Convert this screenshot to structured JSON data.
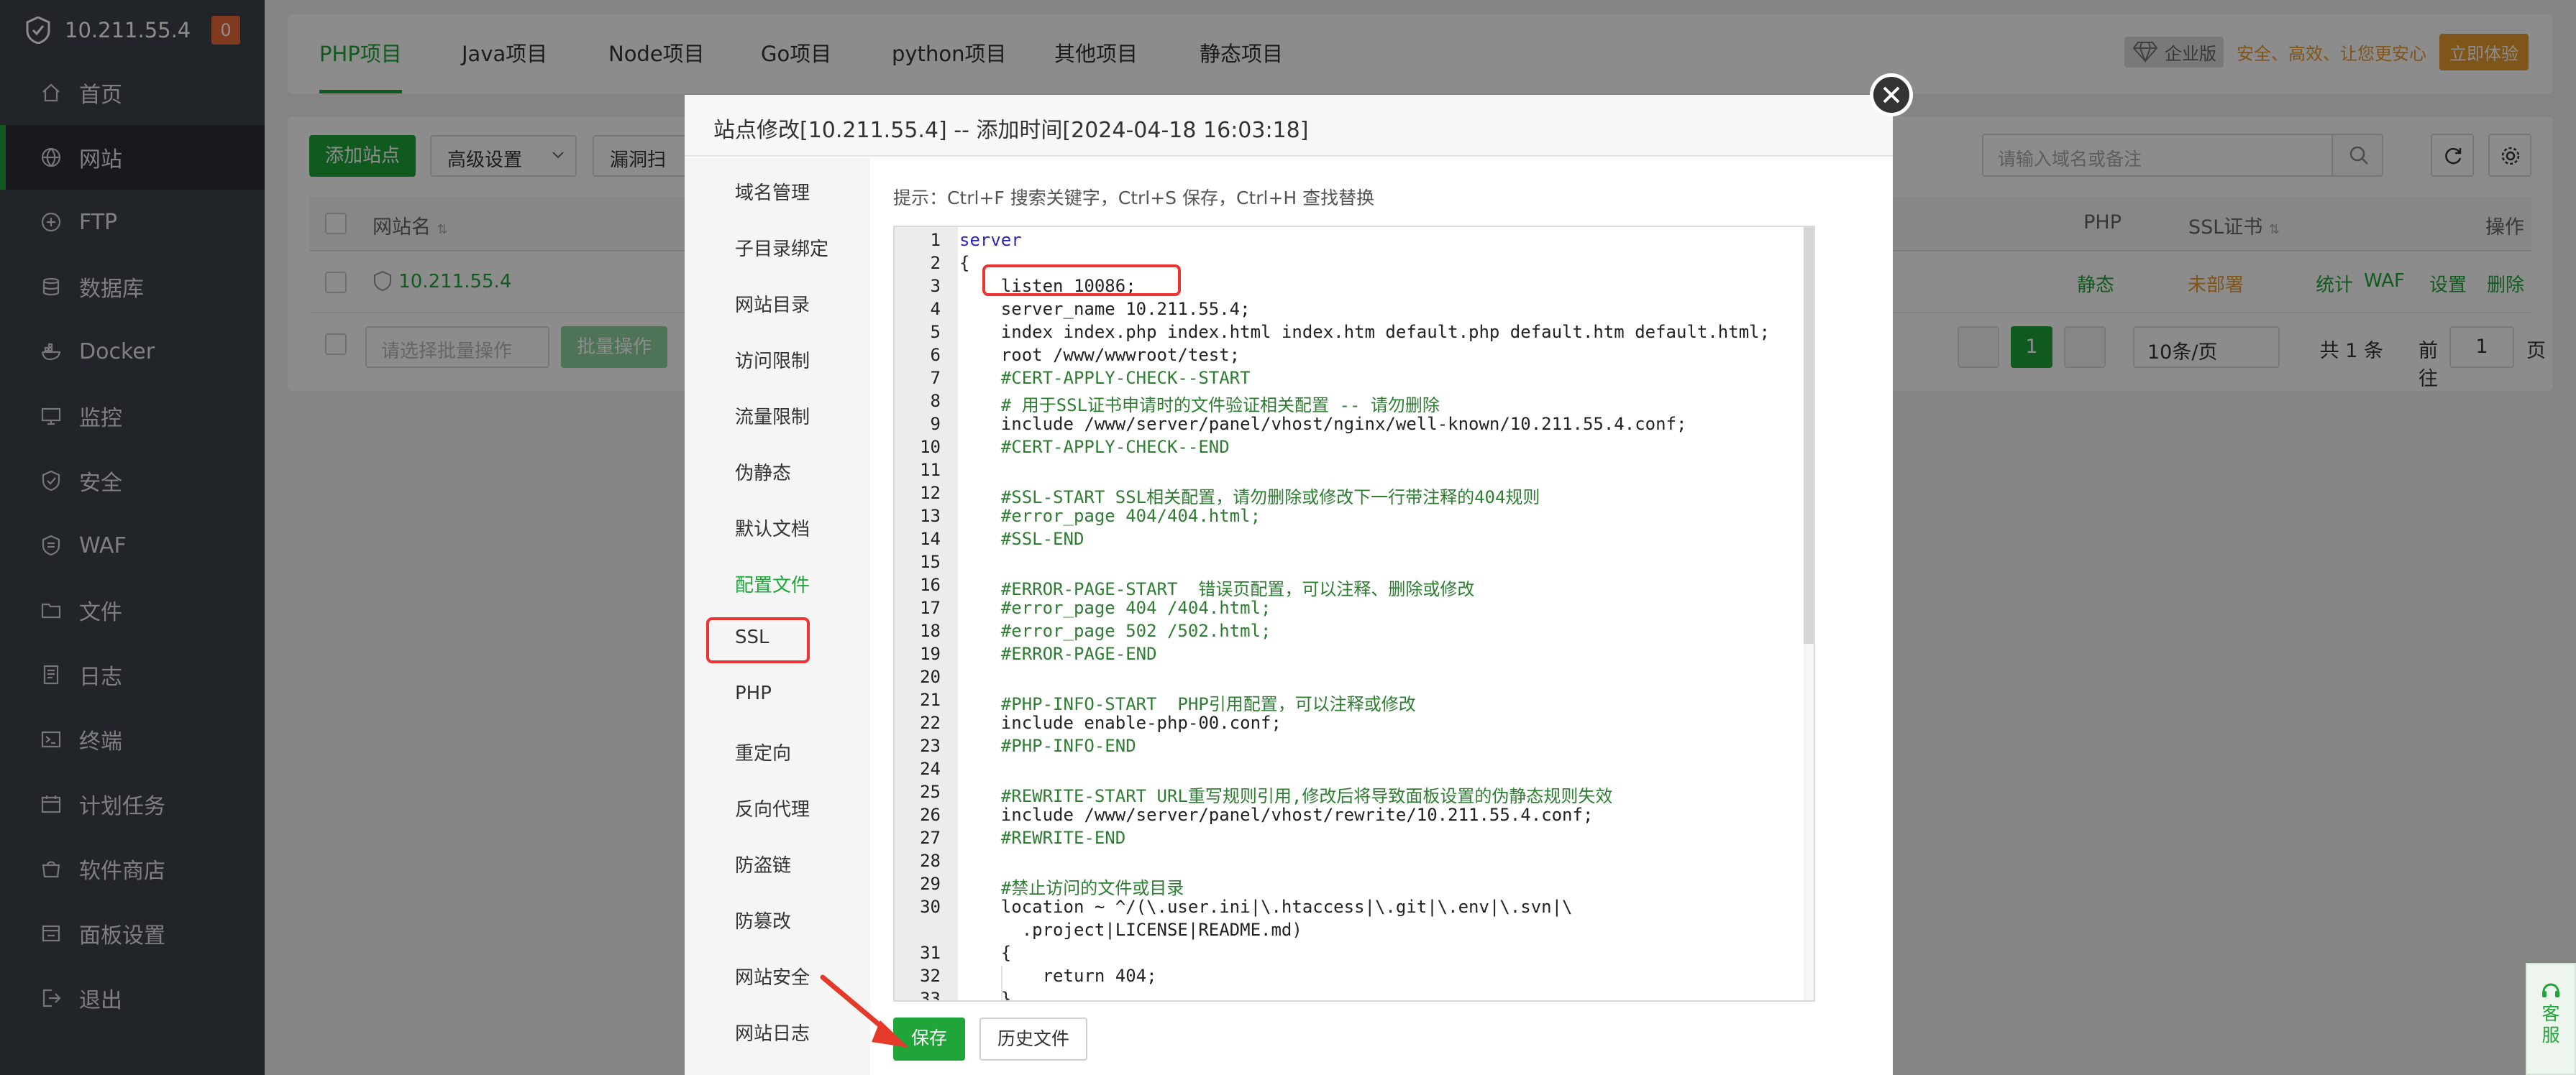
{
  "sidebar": {
    "server_ip": "10.211.55.4",
    "badge": "0",
    "items": [
      {
        "label": "首页",
        "icon": "home-icon",
        "active": false
      },
      {
        "label": "网站",
        "icon": "globe-icon",
        "active": true
      },
      {
        "label": "FTP",
        "icon": "ftp-icon",
        "active": false
      },
      {
        "label": "数据库",
        "icon": "database-icon",
        "active": false
      },
      {
        "label": "Docker",
        "icon": "docker-icon",
        "active": false
      },
      {
        "label": "监控",
        "icon": "monitor-icon",
        "active": false
      },
      {
        "label": "安全",
        "icon": "shield-icon",
        "active": false
      },
      {
        "label": "WAF",
        "icon": "waf-icon",
        "active": false
      },
      {
        "label": "文件",
        "icon": "folder-icon",
        "active": false
      },
      {
        "label": "日志",
        "icon": "log-icon",
        "active": false
      },
      {
        "label": "终端",
        "icon": "terminal-icon",
        "active": false
      },
      {
        "label": "计划任务",
        "icon": "calendar-icon",
        "active": false
      },
      {
        "label": "软件商店",
        "icon": "store-icon",
        "active": false
      },
      {
        "label": "面板设置",
        "icon": "settings-icon",
        "active": false
      },
      {
        "label": "退出",
        "icon": "logout-icon",
        "active": false
      }
    ]
  },
  "tabs": [
    "PHP项目",
    "Java项目",
    "Node项目",
    "Go项目",
    "python项目",
    "其他项目",
    "静态项目"
  ],
  "enterprise": {
    "tag": "企业版",
    "slogan": "安全、高效、让您更安心",
    "button": "立即体验"
  },
  "toolbar": {
    "add_site": "添加站点",
    "advanced": "高级设置",
    "scan": "漏洞扫",
    "search_placeholder": "请输入域名或备注"
  },
  "table": {
    "headers": {
      "name": "网站名",
      "php": "PHP",
      "ssl": "SSL证书",
      "ops": "操作"
    },
    "row": {
      "name": "10.211.55.4",
      "php": "静态",
      "ssl": "未部署",
      "ops": [
        "统计",
        "WAF",
        "设置",
        "删除"
      ]
    },
    "bulk_select": "请选择批量操作",
    "bulk_btn": "批量操作"
  },
  "pager": {
    "page": "1",
    "per_page": "10条/页",
    "total": "共 1 条",
    "goto": "前往",
    "goto_value": "1",
    "page_unit": "页"
  },
  "modal": {
    "title": "站点修改[10.211.55.4] -- 添加时间[2024-04-18 16:03:18]",
    "hint": "提示：Ctrl+F 搜索关键字，Ctrl+S 保存，Ctrl+H 查找替换",
    "nav": [
      "域名管理",
      "子目录绑定",
      "网站目录",
      "访问限制",
      "流量限制",
      "伪静态",
      "默认文档",
      "配置文件",
      "SSL",
      "PHP",
      "重定向",
      "反向代理",
      "防盗链",
      "防篡改",
      "网站安全",
      "网站日志"
    ],
    "active_nav": "配置文件",
    "save": "保存",
    "history": "历史文件"
  },
  "code_lines": [
    {
      "n": "1",
      "t": "server"
    },
    {
      "n": "2",
      "t": "{"
    },
    {
      "n": "3",
      "t": "    listen 10086;"
    },
    {
      "n": "4",
      "t": "    server_name 10.211.55.4;"
    },
    {
      "n": "5",
      "t": "    index index.php index.html index.htm default.php default.htm default.html;"
    },
    {
      "n": "6",
      "t": "    root /www/wwwroot/test;"
    },
    {
      "n": "7",
      "t": "    #CERT-APPLY-CHECK--START"
    },
    {
      "n": "8",
      "t": "    # 用于SSL证书申请时的文件验证相关配置 -- 请勿删除"
    },
    {
      "n": "9",
      "t": "    include /www/server/panel/vhost/nginx/well-known/10.211.55.4.conf;"
    },
    {
      "n": "10",
      "t": "    #CERT-APPLY-CHECK--END"
    },
    {
      "n": "11",
      "t": ""
    },
    {
      "n": "12",
      "t": "    #SSL-START SSL相关配置，请勿删除或修改下一行带注释的404规则"
    },
    {
      "n": "13",
      "t": "    #error_page 404/404.html;"
    },
    {
      "n": "14",
      "t": "    #SSL-END"
    },
    {
      "n": "15",
      "t": ""
    },
    {
      "n": "16",
      "t": "    #ERROR-PAGE-START  错误页配置，可以注释、删除或修改"
    },
    {
      "n": "17",
      "t": "    #error_page 404 /404.html;"
    },
    {
      "n": "18",
      "t": "    #error_page 502 /502.html;"
    },
    {
      "n": "19",
      "t": "    #ERROR-PAGE-END"
    },
    {
      "n": "20",
      "t": ""
    },
    {
      "n": "21",
      "t": "    #PHP-INFO-START  PHP引用配置，可以注释或修改"
    },
    {
      "n": "22",
      "t": "    include enable-php-00.conf;"
    },
    {
      "n": "23",
      "t": "    #PHP-INFO-END"
    },
    {
      "n": "24",
      "t": ""
    },
    {
      "n": "25",
      "t": "    #REWRITE-START URL重写规则引用,修改后将导致面板设置的伪静态规则失效"
    },
    {
      "n": "26",
      "t": "    include /www/server/panel/vhost/rewrite/10.211.55.4.conf;"
    },
    {
      "n": "27",
      "t": "    #REWRITE-END"
    },
    {
      "n": "28",
      "t": ""
    },
    {
      "n": "29",
      "t": "    #禁止访问的文件或目录"
    },
    {
      "n": "30",
      "t": "    location ~ ^/(\\.user.ini|\\.htaccess|\\.git|\\.env|\\.svn|\\"
    },
    {
      "n": "",
      "t": "      .project|LICENSE|README.md)"
    },
    {
      "n": "31",
      "t": "    {"
    },
    {
      "n": "32",
      "t": "        return 404;"
    },
    {
      "n": "33",
      "t": "    }"
    }
  ],
  "kefu": "客服"
}
